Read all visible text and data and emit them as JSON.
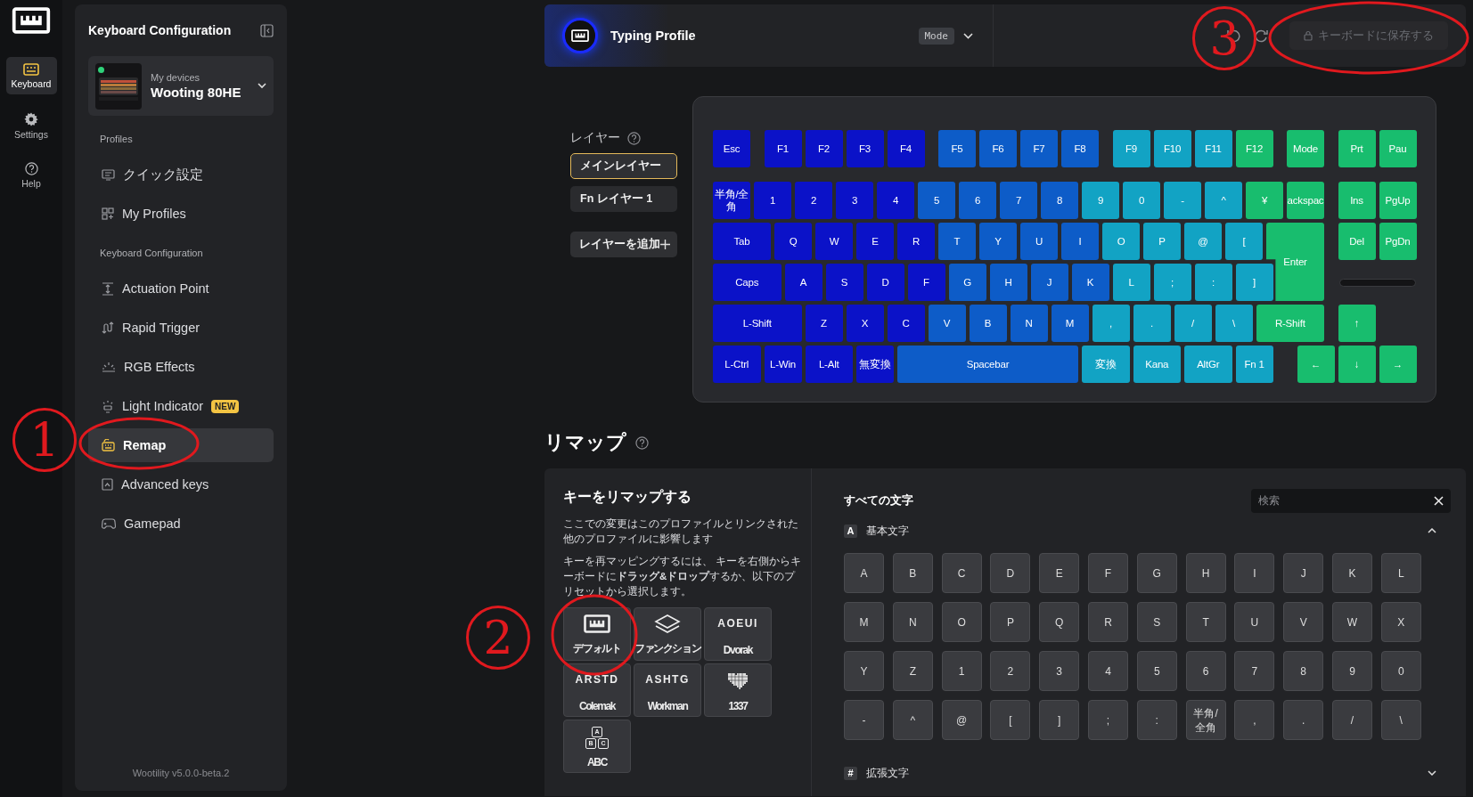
{
  "rail": {
    "items": [
      {
        "label": "Keyboard",
        "selected": true
      },
      {
        "label": "Settings",
        "selected": false
      },
      {
        "label": "Help",
        "selected": false
      }
    ]
  },
  "sidebar": {
    "title": "Keyboard Configuration",
    "device": {
      "caption": "My devices",
      "name": "Wooting 80HE",
      "connected": true
    },
    "groups": [
      {
        "title": "Profiles",
        "items": [
          {
            "label": "クイック設定",
            "selected": false
          },
          {
            "label": "My Profiles",
            "selected": false
          }
        ]
      },
      {
        "title": "Keyboard Configuration",
        "items": [
          {
            "label": "Actuation Point",
            "selected": false
          },
          {
            "label": "Rapid Trigger",
            "selected": false
          },
          {
            "label": "RGB Effects",
            "selected": false
          },
          {
            "label": "Light Indicator",
            "badge": "NEW",
            "selected": false
          },
          {
            "label": "Remap",
            "selected": true
          },
          {
            "label": "Advanced keys",
            "selected": false
          },
          {
            "label": "Gamepad",
            "selected": false
          }
        ]
      }
    ],
    "footer": "Wootility v5.0.0-beta.2"
  },
  "top_bar": {
    "profile": "Typing Profile",
    "mode": "Mode",
    "save_button": {
      "label": "キーボードに保存する",
      "disabled": true
    }
  },
  "layers": {
    "title": "レイヤー",
    "items": [
      {
        "label": "メインレイヤー",
        "selected": true
      },
      {
        "label": "Fn レイヤー 1",
        "selected": false
      }
    ],
    "add_button": "レイヤーを追加"
  },
  "keyboard": {
    "rows": [
      {
        "keys": [
          {
            "label": "Esc",
            "color": "#0b12c8"
          },
          {
            "label": "F1",
            "color": "#0b12c8"
          },
          {
            "label": "F2",
            "color": "#0b12c8"
          },
          {
            "label": "F3",
            "color": "#0b12c8"
          },
          {
            "label": "F4",
            "color": "#0b12c8"
          },
          {
            "label": "F5",
            "color": "#0d5cc8"
          },
          {
            "label": "F6",
            "color": "#0d5cc8"
          },
          {
            "label": "F7",
            "color": "#0d5cc8"
          },
          {
            "label": "F8",
            "color": "#0d5cc8"
          },
          {
            "label": "F9",
            "color": "#12a3c4"
          },
          {
            "label": "F10",
            "color": "#12a3c4"
          },
          {
            "label": "F11",
            "color": "#12a3c4"
          },
          {
            "label": "F12",
            "color": "#18bd6e"
          },
          {
            "label": "Mode",
            "color": "#18bd6e"
          },
          {
            "label": "Prt",
            "color": "#18bd6e"
          },
          {
            "label": "Pau",
            "color": "#18bd6e"
          }
        ]
      },
      {
        "keys": [
          {
            "label": "半角/全角",
            "color": "#0b12c8"
          },
          {
            "label": "1",
            "color": "#0b12c8"
          },
          {
            "label": "2",
            "color": "#0b12c8"
          },
          {
            "label": "3",
            "color": "#0b12c8"
          },
          {
            "label": "4",
            "color": "#0b12c8"
          },
          {
            "label": "5",
            "color": "#0d5cc8"
          },
          {
            "label": "6",
            "color": "#0d5cc8"
          },
          {
            "label": "7",
            "color": "#0d5cc8"
          },
          {
            "label": "8",
            "color": "#0d5cc8"
          },
          {
            "label": "9",
            "color": "#12a3c4"
          },
          {
            "label": "0",
            "color": "#12a3c4"
          },
          {
            "label": "-",
            "color": "#12a3c4"
          },
          {
            "label": "^",
            "color": "#12a3c4"
          },
          {
            "label": "¥",
            "color": "#18bd6e"
          },
          {
            "label": "ackspac",
            "color": "#18bd6e"
          },
          {
            "label": "Ins",
            "color": "#18bd6e"
          },
          {
            "label": "PgUp",
            "color": "#18bd6e"
          }
        ]
      },
      {
        "keys": [
          {
            "label": "Tab",
            "color": "#0b12c8"
          },
          {
            "label": "Q",
            "color": "#0b12c8"
          },
          {
            "label": "W",
            "color": "#0b12c8"
          },
          {
            "label": "E",
            "color": "#0b12c8"
          },
          {
            "label": "R",
            "color": "#0b12c8"
          },
          {
            "label": "T",
            "color": "#0d5cc8"
          },
          {
            "label": "Y",
            "color": "#0d5cc8"
          },
          {
            "label": "U",
            "color": "#0d5cc8"
          },
          {
            "label": "I",
            "color": "#0d5cc8"
          },
          {
            "label": "O",
            "color": "#12a3c4"
          },
          {
            "label": "P",
            "color": "#12a3c4"
          },
          {
            "label": "@",
            "color": "#12a3c4"
          },
          {
            "label": "[",
            "color": "#12a3c4"
          },
          {
            "label": "Enter",
            "color": "#18bd6e"
          },
          {
            "label": "Del",
            "color": "#18bd6e"
          },
          {
            "label": "PgDn",
            "color": "#18bd6e"
          }
        ]
      },
      {
        "keys": [
          {
            "label": "Caps",
            "color": "#0b12c8"
          },
          {
            "label": "A",
            "color": "#0b12c8"
          },
          {
            "label": "S",
            "color": "#0b12c8"
          },
          {
            "label": "D",
            "color": "#0b12c8"
          },
          {
            "label": "F",
            "color": "#0b12c8"
          },
          {
            "label": "G",
            "color": "#0d5cc8"
          },
          {
            "label": "H",
            "color": "#0d5cc8"
          },
          {
            "label": "J",
            "color": "#0d5cc8"
          },
          {
            "label": "K",
            "color": "#0d5cc8"
          },
          {
            "label": "L",
            "color": "#12a3c4"
          },
          {
            "label": ";",
            "color": "#12a3c4"
          },
          {
            "label": ":",
            "color": "#12a3c4"
          },
          {
            "label": "]",
            "color": "#12a3c4"
          }
        ]
      },
      {
        "keys": [
          {
            "label": "L-Shift",
            "color": "#0b12c8"
          },
          {
            "label": "Z",
            "color": "#0b12c8"
          },
          {
            "label": "X",
            "color": "#0b12c8"
          },
          {
            "label": "C",
            "color": "#0b12c8"
          },
          {
            "label": "V",
            "color": "#0d5cc8"
          },
          {
            "label": "B",
            "color": "#0d5cc8"
          },
          {
            "label": "N",
            "color": "#0d5cc8"
          },
          {
            "label": "M",
            "color": "#0d5cc8"
          },
          {
            "label": ",",
            "color": "#12a3c4"
          },
          {
            "label": ".",
            "color": "#12a3c4"
          },
          {
            "label": "/",
            "color": "#12a3c4"
          },
          {
            "label": "\\",
            "color": "#12a3c4"
          },
          {
            "label": "R-Shift",
            "color": "#18bd6e"
          },
          {
            "label": "↑",
            "color": "#18bd6e"
          }
        ]
      },
      {
        "keys": [
          {
            "label": "L-Ctrl",
            "color": "#0b12c8"
          },
          {
            "label": "L-Win",
            "color": "#0b12c8"
          },
          {
            "label": "L-Alt",
            "color": "#0b12c8"
          },
          {
            "label": "無変換",
            "color": "#0b12c8"
          },
          {
            "label": "Spacebar",
            "color": "#0d5cc8"
          },
          {
            "label": "変換",
            "color": "#12a3c4"
          },
          {
            "label": "Kana",
            "color": "#12a3c4"
          },
          {
            "label": "AltGr",
            "color": "#12a3c4"
          },
          {
            "label": "Fn 1",
            "color": "#12a3c4"
          },
          {
            "label": "←",
            "color": "#18bd6e"
          },
          {
            "label": "↓",
            "color": "#18bd6e"
          },
          {
            "label": "→",
            "color": "#18bd6e"
          }
        ]
      }
    ]
  },
  "remap": {
    "heading": "リマップ",
    "title": "キーをリマップする",
    "paragraphs": [
      "ここでの変更はこのプロファイルとリンクされた他のプロファイルに影響します",
      "キーを再マッピングするには、 キーを右側からキーボードに**ドラッグ&ドロップ**するか、以下のプリセットから選択します。"
    ],
    "presets": [
      {
        "kind": "logo",
        "label": "デフォルト"
      },
      {
        "kind": "layers",
        "label": "ファンクション"
      },
      {
        "kind": "text",
        "glyphs": "AOEUI",
        "label": "Dvorak"
      },
      {
        "kind": "text",
        "glyphs": "ARSTD",
        "label": "Colemak"
      },
      {
        "kind": "text",
        "glyphs": "ASHTG",
        "label": "Workman"
      },
      {
        "kind": "heart",
        "label": "1337"
      },
      {
        "kind": "blocks",
        "glyphs": [
          "A",
          "B",
          "C"
        ],
        "label": "ABC"
      }
    ]
  },
  "characters": {
    "title": "すべての文字",
    "search": {
      "placeholder": "検索"
    },
    "sections": [
      {
        "badge": "A",
        "title": "基本文字",
        "expanded": true,
        "keys": [
          "A",
          "B",
          "C",
          "D",
          "E",
          "F",
          "G",
          "H",
          "I",
          "J",
          "K",
          "L",
          "M",
          "N",
          "O",
          "P",
          "Q",
          "R",
          "S",
          "T",
          "U",
          "V",
          "W",
          "X",
          "Y",
          "Z",
          "1",
          "2",
          "3",
          "4",
          "5",
          "6",
          "7",
          "8",
          "9",
          "0",
          "-",
          "^",
          "@",
          "[",
          "]",
          ";",
          ":",
          "半角/全角",
          ",",
          ".",
          "/",
          "\\"
        ]
      },
      {
        "badge": "#",
        "title": "拡張文字",
        "expanded": false
      }
    ]
  },
  "annotations": [
    {
      "number": "1"
    },
    {
      "number": "2"
    },
    {
      "number": "3"
    }
  ]
}
